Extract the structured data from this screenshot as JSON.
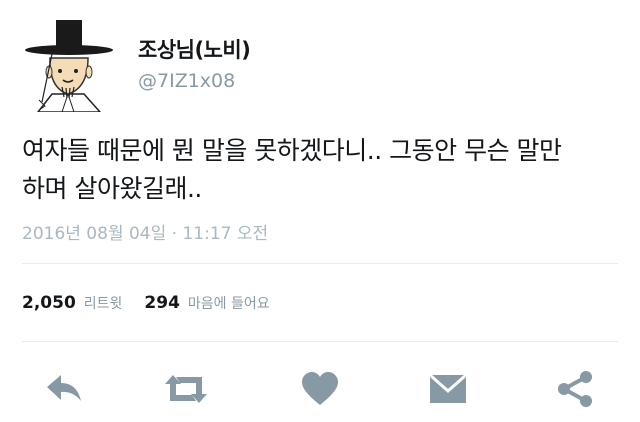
{
  "user": {
    "display_name": "조상님(노비)",
    "handle": "@7IZ1x08",
    "avatar_icon": "gat-hat-man-avatar"
  },
  "tweet": {
    "text_line1": "여자들 때문에 뭔 말을 못하겠다니.. 그동안 무슨 말만",
    "text_line2": "하며 살아왔길래..",
    "timestamp": "2016년 08월 04일 · 11:17 오전"
  },
  "stats": {
    "retweets_count": "2,050",
    "retweets_label": "리트윗",
    "likes_count": "294",
    "likes_label": "마음에 들어요"
  },
  "actions": [
    {
      "name": "reply",
      "icon": "reply-icon"
    },
    {
      "name": "retweet",
      "icon": "retweet-icon"
    },
    {
      "name": "like",
      "icon": "heart-icon"
    },
    {
      "name": "message",
      "icon": "envelope-icon"
    },
    {
      "name": "share",
      "icon": "share-icon"
    }
  ],
  "colors": {
    "icon": "#8899a6",
    "text_primary": "#14171a",
    "text_secondary": "#8899a6"
  }
}
